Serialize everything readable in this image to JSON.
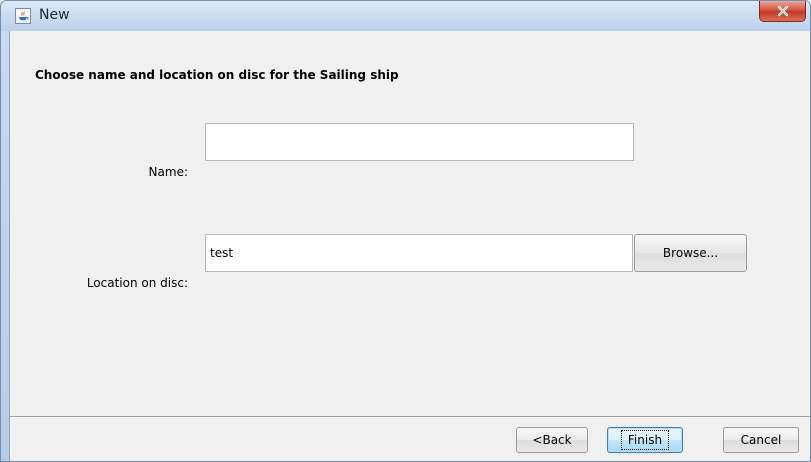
{
  "window": {
    "title": "New",
    "close_icon": "close-icon",
    "app_icon": "java-icon"
  },
  "dialog": {
    "heading": "Choose name and location on disc for the Sailing ship",
    "name_label": "Name:",
    "name_value": "",
    "location_label": "Location on disc:",
    "location_value": "test",
    "browse_label": "Browse..."
  },
  "footer": {
    "back_label": "<Back",
    "finish_label": "Finish",
    "cancel_label": "Cancel"
  }
}
